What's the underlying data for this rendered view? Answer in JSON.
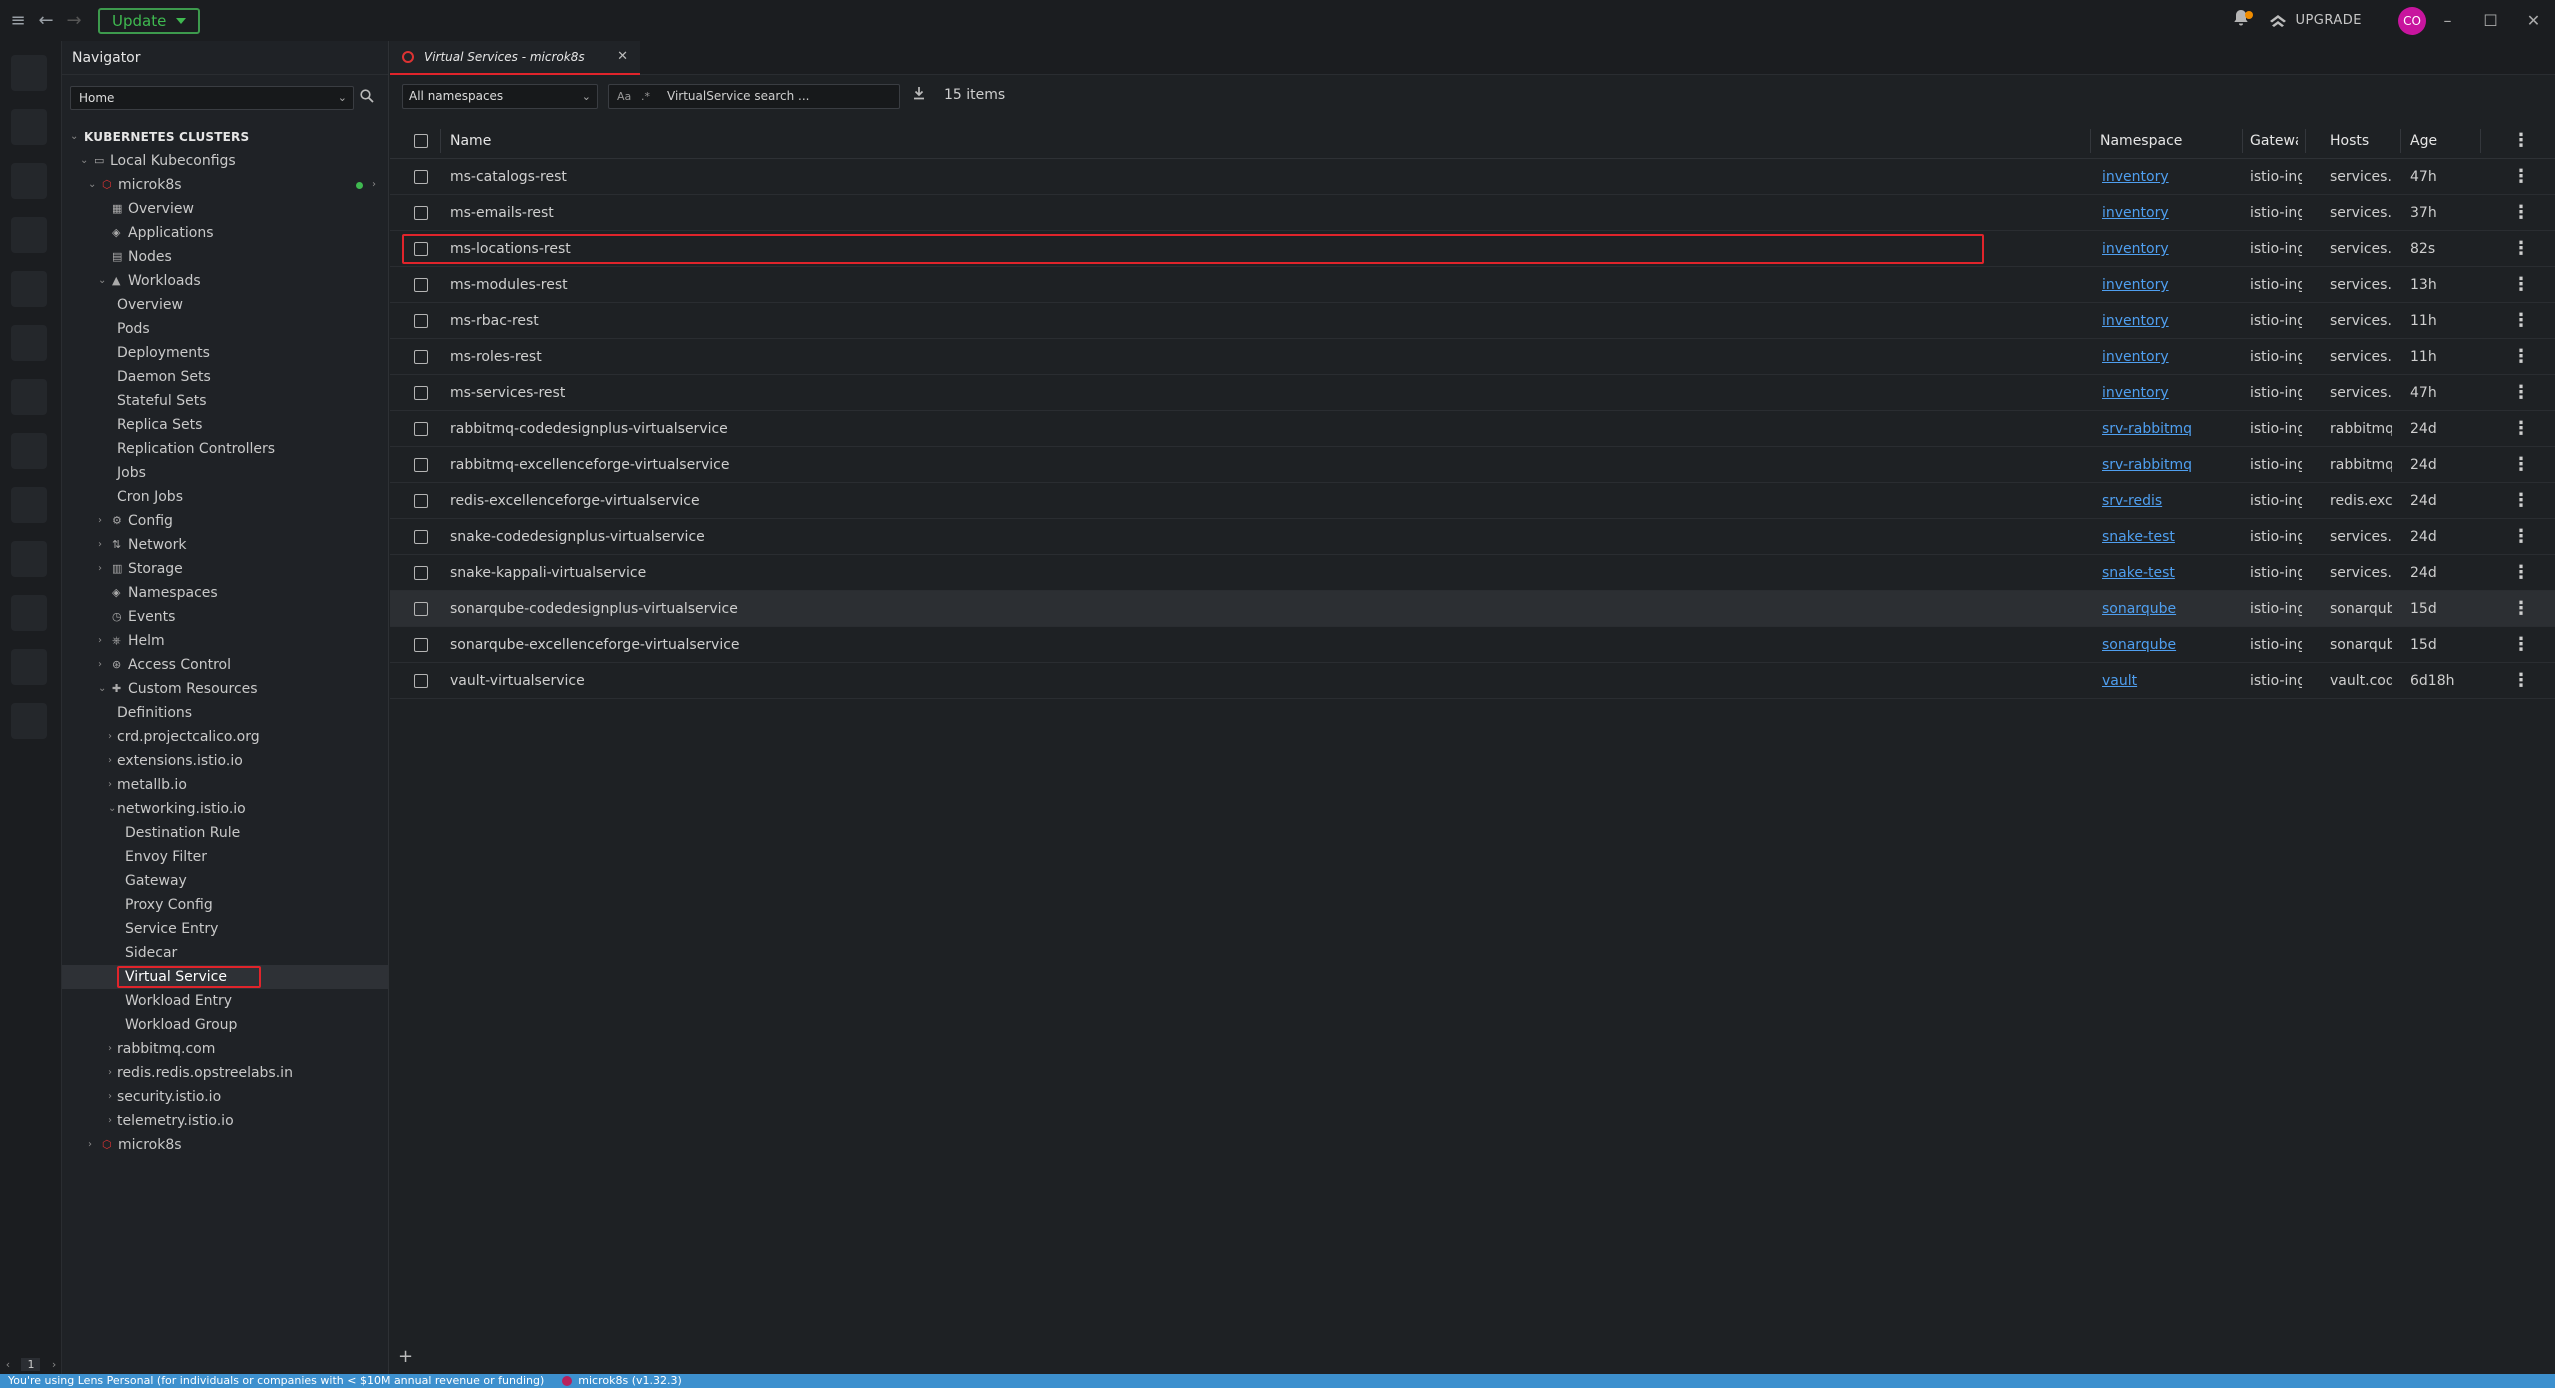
{
  "titlebar": {
    "update_label": "Update",
    "upgrade_label": "UPGRADE",
    "avatar_initials": "CO"
  },
  "navigator": {
    "title": "Navigator",
    "home_select": "Home",
    "tree": [
      {
        "label": "KUBERNETES CLUSTERS",
        "level": 0,
        "arrow": "v",
        "icon": "",
        "section": true
      },
      {
        "label": "Local Kubeconfigs",
        "level": 1,
        "arrow": "v",
        "icon": "laptop-icon"
      },
      {
        "label": "microk8s",
        "level": 2,
        "arrow": "v",
        "icon": "cluster-icon",
        "status": "connected"
      },
      {
        "label": "Overview",
        "level": 3,
        "arrow": "",
        "icon": "grid-icon"
      },
      {
        "label": "Applications",
        "level": 3,
        "arrow": "",
        "icon": "apps-icon"
      },
      {
        "label": "Nodes",
        "level": 3,
        "arrow": "",
        "icon": "nodes-icon"
      },
      {
        "label": "Workloads",
        "level": 3,
        "arrow": "v",
        "icon": "workloads-icon"
      },
      {
        "label": "Overview",
        "level": 4
      },
      {
        "label": "Pods",
        "level": 4
      },
      {
        "label": "Deployments",
        "level": 4
      },
      {
        "label": "Daemon Sets",
        "level": 4
      },
      {
        "label": "Stateful Sets",
        "level": 4
      },
      {
        "label": "Replica Sets",
        "level": 4
      },
      {
        "label": "Replication Controllers",
        "level": 4
      },
      {
        "label": "Jobs",
        "level": 4
      },
      {
        "label": "Cron Jobs",
        "level": 4
      },
      {
        "label": "Config",
        "level": 3,
        "arrow": ">",
        "icon": "config-icon"
      },
      {
        "label": "Network",
        "level": 3,
        "arrow": ">",
        "icon": "network-icon"
      },
      {
        "label": "Storage",
        "level": 3,
        "arrow": ">",
        "icon": "storage-icon"
      },
      {
        "label": "Namespaces",
        "level": 3,
        "arrow": "",
        "icon": "namespaces-icon"
      },
      {
        "label": "Events",
        "level": 3,
        "arrow": "",
        "icon": "events-icon"
      },
      {
        "label": "Helm",
        "level": 3,
        "arrow": ">",
        "icon": "helm-icon"
      },
      {
        "label": "Access Control",
        "level": 3,
        "arrow": ">",
        "icon": "access-control-icon"
      },
      {
        "label": "Custom Resources",
        "level": 3,
        "arrow": "v",
        "icon": "puzzle-icon"
      },
      {
        "label": "Definitions",
        "level": 4
      },
      {
        "label": "crd.projectcalico.org",
        "level": 4,
        "arrow": ">"
      },
      {
        "label": "extensions.istio.io",
        "level": 4,
        "arrow": ">"
      },
      {
        "label": "metallb.io",
        "level": 4,
        "arrow": ">"
      },
      {
        "label": "networking.istio.io",
        "level": 4,
        "arrow": "v"
      },
      {
        "label": "Destination Rule",
        "level": 5
      },
      {
        "label": "Envoy Filter",
        "level": 5
      },
      {
        "label": "Gateway",
        "level": 5
      },
      {
        "label": "Proxy Config",
        "level": 5
      },
      {
        "label": "Service Entry",
        "level": 5
      },
      {
        "label": "Sidecar",
        "level": 5
      },
      {
        "label": "Virtual Service",
        "level": 5,
        "active": true
      },
      {
        "label": "Workload Entry",
        "level": 5
      },
      {
        "label": "Workload Group",
        "level": 5
      },
      {
        "label": "rabbitmq.com",
        "level": 4,
        "arrow": ">"
      },
      {
        "label": "redis.redis.opstreelabs.in",
        "level": 4,
        "arrow": ">"
      },
      {
        "label": "security.istio.io",
        "level": 4,
        "arrow": ">"
      },
      {
        "label": "telemetry.istio.io",
        "level": 4,
        "arrow": ">"
      },
      {
        "label": "microk8s",
        "level": 2,
        "arrow": ">",
        "icon": "cluster-icon"
      }
    ],
    "footer_page": "1"
  },
  "main": {
    "tab_label": "Virtual Services - microk8s",
    "namespace_select": "All namespaces",
    "search_case_label": "Aa",
    "search_regex_label": ".*",
    "search_placeholder": "VirtualService search ...",
    "items_count": "15 items",
    "columns": {
      "name": "Name",
      "namespace": "Namespace",
      "gateways": "Gatewa",
      "hosts": "Hosts",
      "age": "Age"
    },
    "rows": [
      {
        "name": "ms-catalogs-rest",
        "namespace": "inventory",
        "gateways": "istio-ingre:",
        "hosts": "services.cc",
        "age": "47h"
      },
      {
        "name": "ms-emails-rest",
        "namespace": "inventory",
        "gateways": "istio-ingre:",
        "hosts": "services.cc",
        "age": "37h"
      },
      {
        "name": "ms-locations-rest",
        "namespace": "inventory",
        "gateways": "istio-ingre:",
        "hosts": "services.cc",
        "age": "82s",
        "highlighted": true
      },
      {
        "name": "ms-modules-rest",
        "namespace": "inventory",
        "gateways": "istio-ingre:",
        "hosts": "services.cc",
        "age": "13h"
      },
      {
        "name": "ms-rbac-rest",
        "namespace": "inventory",
        "gateways": "istio-ingre:",
        "hosts": "services.cc",
        "age": "11h"
      },
      {
        "name": "ms-roles-rest",
        "namespace": "inventory",
        "gateways": "istio-ingre:",
        "hosts": "services.cc",
        "age": "11h"
      },
      {
        "name": "ms-services-rest",
        "namespace": "inventory",
        "gateways": "istio-ingre:",
        "hosts": "services.cc",
        "age": "47h"
      },
      {
        "name": "rabbitmq-codedesignplus-virtualservice",
        "namespace": "srv-rabbitmq",
        "gateways": "istio-ingre:",
        "hosts": "rabbitmq.c",
        "age": "24d"
      },
      {
        "name": "rabbitmq-excellenceforge-virtualservice",
        "namespace": "srv-rabbitmq",
        "gateways": "istio-ingre:",
        "hosts": "rabbitmq.c",
        "age": "24d"
      },
      {
        "name": "redis-excellenceforge-virtualservice",
        "namespace": "srv-redis",
        "gateways": "istio-ingre:",
        "hosts": "redis.exce",
        "age": "24d"
      },
      {
        "name": "snake-codedesignplus-virtualservice",
        "namespace": "snake-test",
        "gateways": "istio-ingre:",
        "hosts": "services.cc",
        "age": "24d"
      },
      {
        "name": "snake-kappali-virtualservice",
        "namespace": "snake-test",
        "gateways": "istio-ingre:",
        "hosts": "services.ka",
        "age": "24d"
      },
      {
        "name": "sonarqube-codedesignplus-virtualservice",
        "namespace": "sonarqube",
        "gateways": "istio-ingre:",
        "hosts": "sonarqube",
        "age": "15d",
        "hover": true
      },
      {
        "name": "sonarqube-excellenceforge-virtualservice",
        "namespace": "sonarqube",
        "gateways": "istio-ingre:",
        "hosts": "sonarqube",
        "age": "15d"
      },
      {
        "name": "vault-virtualservice",
        "namespace": "vault",
        "gateways": "istio-ingre:",
        "hosts": "vault.code",
        "age": "6d18h"
      }
    ]
  },
  "statusbar": {
    "message": "You're using Lens Personal (for individuals or companies with < $10M annual revenue or funding)",
    "cluster": "microk8s (v1.32.3)"
  },
  "colors": {
    "accent_red": "#e0242b",
    "link_blue": "#4f9ff0",
    "status_blue": "#3d90ce",
    "update_green": "#3fb950"
  }
}
